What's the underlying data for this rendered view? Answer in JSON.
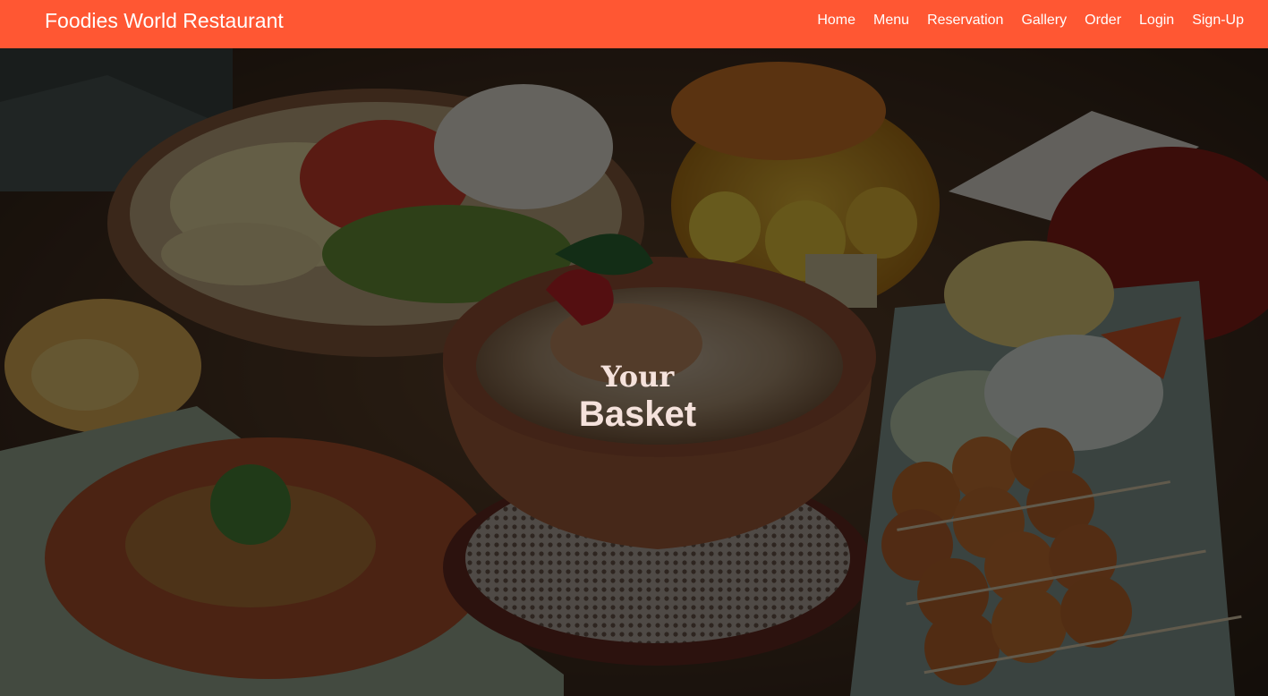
{
  "navbar": {
    "brand": "Foodies World Restaurant",
    "background_color": "#ff5733",
    "links": [
      {
        "label": "Home"
      },
      {
        "label": "Menu"
      },
      {
        "label": "Reservation"
      },
      {
        "label": "Gallery"
      },
      {
        "label": "Order"
      },
      {
        "label": "Login"
      },
      {
        "label": "Sign-Up"
      }
    ]
  },
  "hero": {
    "title_top": "Your",
    "title_bottom": "Basket",
    "background_image": "dimmed photo of Thai dishes: vegetable platter, curry bowl on saucer, salad, meatball skewers, flowers"
  }
}
